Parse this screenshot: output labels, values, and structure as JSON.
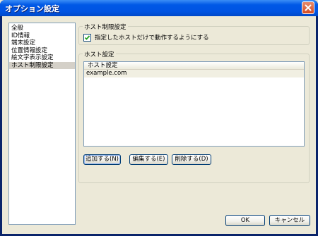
{
  "window": {
    "title": "オプション設定"
  },
  "sidebar": {
    "items": [
      {
        "label": "全般"
      },
      {
        "label": "ID情報"
      },
      {
        "label": "端末設定"
      },
      {
        "label": "位置情報設定"
      },
      {
        "label": "絵文字表示設定"
      },
      {
        "label": "ホスト制限設定",
        "selected": true
      }
    ]
  },
  "host_restriction": {
    "group_label": "ホスト制限設定",
    "checkbox_label": "指定したホストだけで動作するようにする",
    "checked": true
  },
  "host_settings": {
    "group_label": "ホスト設定",
    "column_header": "ホスト設定",
    "rows": [
      "example.com"
    ],
    "add_label": "追加する(N)",
    "edit_label": "編集する(E)",
    "delete_label": "削除する(D)"
  },
  "footer": {
    "ok_label": "OK",
    "cancel_label": "キャンセル"
  },
  "colors": {
    "titlebar": "#0054e3",
    "close_button": "#d34a22",
    "dialog_bg": "#ece9d8"
  }
}
